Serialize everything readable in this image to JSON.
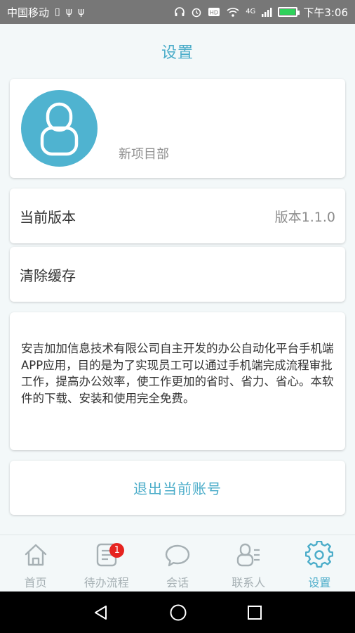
{
  "status_bar": {
    "carrier": "中国移动",
    "network": "4G",
    "battery_level": 1.0,
    "time": "下午3:06"
  },
  "header": {
    "title": "设置"
  },
  "profile": {
    "department": "新项目部"
  },
  "version_row": {
    "label": "当前版本",
    "value": "版本1.1.0"
  },
  "cache_row": {
    "label": "清除缓存"
  },
  "about": {
    "text": "安吉加加信息技术有限公司自主开发的办公自动化平台手机端APP应用，目的是为了实现员工可以通过手机端完成流程审批工作，提高办公效率，使工作更加的省时、省力、省心。本软件的下载、安装和使用完全免费。"
  },
  "logout": {
    "label": "退出当前账号"
  },
  "tabs": [
    {
      "label": "首页",
      "icon": "home-icon"
    },
    {
      "label": "待办流程",
      "icon": "todo-list-icon",
      "badge": "1"
    },
    {
      "label": "会话",
      "icon": "chat-bubble-icon"
    },
    {
      "label": "联系人",
      "icon": "contacts-icon"
    },
    {
      "label": "设置",
      "icon": "gear-icon",
      "active": true
    }
  ],
  "colors": {
    "accent": "#4aacc9",
    "inactive": "#a6b0b4",
    "badge": "#e62420",
    "status_bar": "#777777",
    "background": "#f3f8f9"
  }
}
